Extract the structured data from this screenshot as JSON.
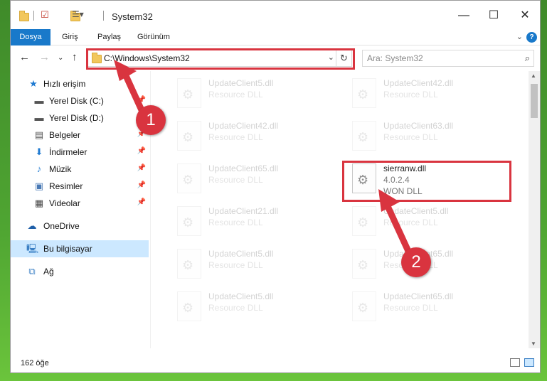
{
  "window": {
    "title": "System32",
    "controls": {
      "minimize": "—",
      "maximize": "☐",
      "close": "✕"
    }
  },
  "ribbon": {
    "tabs": [
      "Dosya",
      "Giriş",
      "Paylaş",
      "Görünüm"
    ],
    "help": "?"
  },
  "nav": {
    "address": "C:\\Windows\\System32",
    "search_placeholder": "Ara: System32"
  },
  "sidebar": {
    "items": [
      {
        "label": "Hızlı erişim",
        "icon": "star-icon"
      },
      {
        "label": "Yerel Disk (C:)",
        "icon": "drive-icon"
      },
      {
        "label": "Yerel Disk (D:)",
        "icon": "drive-icon"
      },
      {
        "label": "Belgeler",
        "icon": "documents-icon"
      },
      {
        "label": "İndirmeler",
        "icon": "download-icon"
      },
      {
        "label": "Müzik",
        "icon": "music-icon"
      },
      {
        "label": "Resimler",
        "icon": "pictures-icon"
      },
      {
        "label": "Videolar",
        "icon": "videos-icon"
      },
      {
        "label": "OneDrive",
        "icon": "cloud-icon"
      },
      {
        "label": "Bu bilgisayar",
        "icon": "computer-icon"
      },
      {
        "label": "Ağ",
        "icon": "network-icon"
      }
    ]
  },
  "files": [
    {
      "name": "UpdateClient5.dll",
      "type": "Resource DLL"
    },
    {
      "name": "UpdateClient42.dll",
      "type": "Resource DLL"
    },
    {
      "name": "UpdateClient42.dll",
      "type": "Resource DLL"
    },
    {
      "name": "UpdateClient63.dll",
      "type": "Resource DLL"
    },
    {
      "name": "UpdateClient65.dll",
      "type": "Resource DLL"
    },
    {
      "name": "sierranw.dll",
      "version": "4.0.2.4",
      "type": "WON DLL"
    },
    {
      "name": "UpdateClient21.dll",
      "type": "Resource DLL"
    },
    {
      "name": "UpdateClient5.dll",
      "type": "Resource DLL"
    },
    {
      "name": "UpdateClient5.dll",
      "type": "Resource DLL"
    },
    {
      "name": "UpdateClient65.dll",
      "type": "Resource DLL"
    },
    {
      "name": "UpdateClient5.dll",
      "type": "Resource DLL"
    },
    {
      "name": "UpdateClient65.dll",
      "type": "Resource DLL"
    }
  ],
  "status": {
    "count": "162 öğe"
  },
  "annotations": {
    "step1": "1",
    "step2": "2",
    "color": "#d9343f"
  }
}
